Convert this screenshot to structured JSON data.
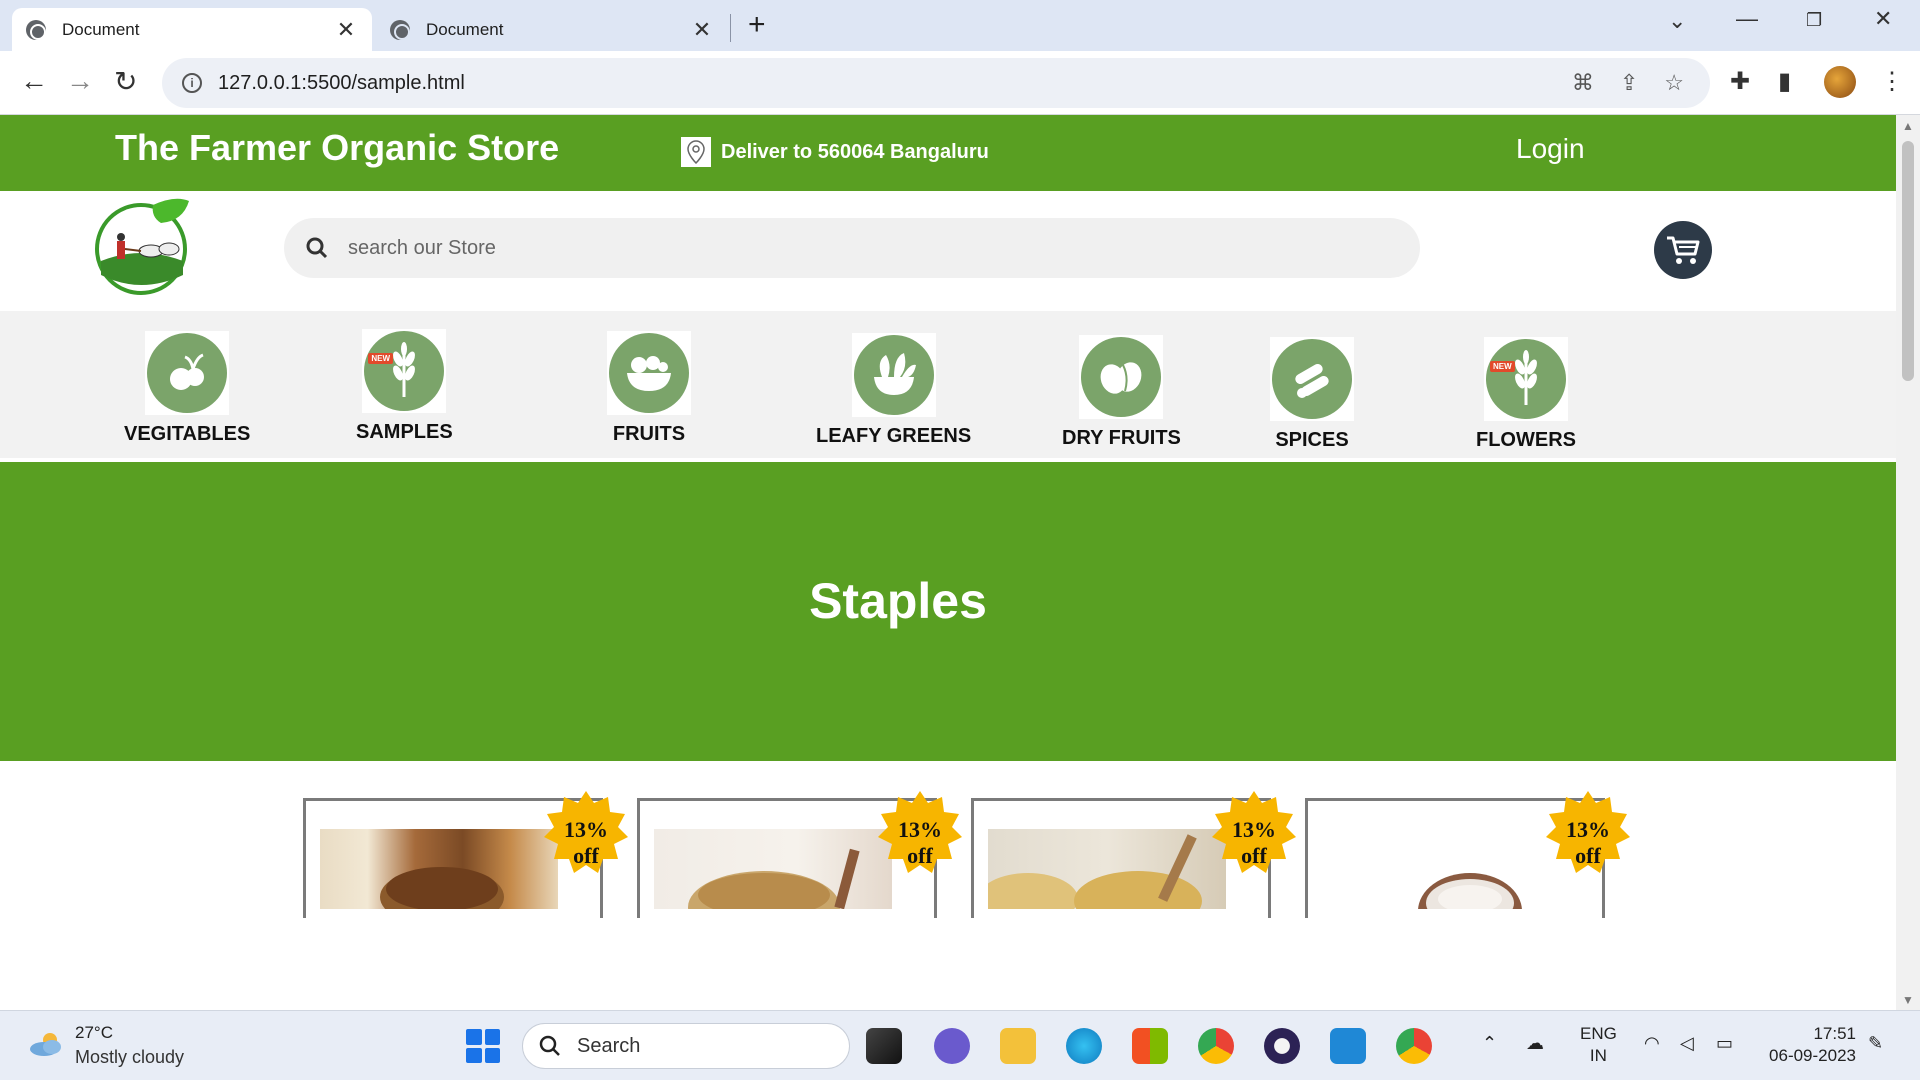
{
  "browser": {
    "tabs": [
      {
        "title": "Document",
        "active": true
      },
      {
        "title": "Document",
        "active": false
      }
    ],
    "url": "127.0.0.1:5500/sample.html"
  },
  "site": {
    "title": "The Farmer Organic Store",
    "deliver": "Deliver to 560064 Bangaluru",
    "login": "Login",
    "search_placeholder": "search our Store",
    "categories": [
      {
        "label": "VEGITABLES",
        "new": false
      },
      {
        "label": "SAMPLES",
        "new": true
      },
      {
        "label": "FRUITS",
        "new": false
      },
      {
        "label": "LEAFY GREENS",
        "new": false
      },
      {
        "label": "DRY FRUITS",
        "new": false
      },
      {
        "label": "SPICES",
        "new": false
      },
      {
        "label": "FLOWERS",
        "new": true
      }
    ],
    "new_tag": "NEW",
    "hero_title": "Staples",
    "products": [
      {
        "discount_line1": "13%",
        "discount_line2": "off"
      },
      {
        "discount_line1": "13%",
        "discount_line2": "off"
      },
      {
        "discount_line1": "13%",
        "discount_line2": "off"
      },
      {
        "discount_line1": "13%",
        "discount_line2": "off"
      }
    ]
  },
  "colors": {
    "brand_green": "#599f22",
    "category_icon": "#7ba46a",
    "badge_yellow": "#f7b500",
    "cart_bg": "#2d3a48"
  },
  "taskbar": {
    "weather_temp": "27°C",
    "weather_desc": "Mostly cloudy",
    "search_label": "Search",
    "lang_line1": "ENG",
    "lang_line2": "IN",
    "time": "17:51",
    "date": "06-09-2023"
  }
}
